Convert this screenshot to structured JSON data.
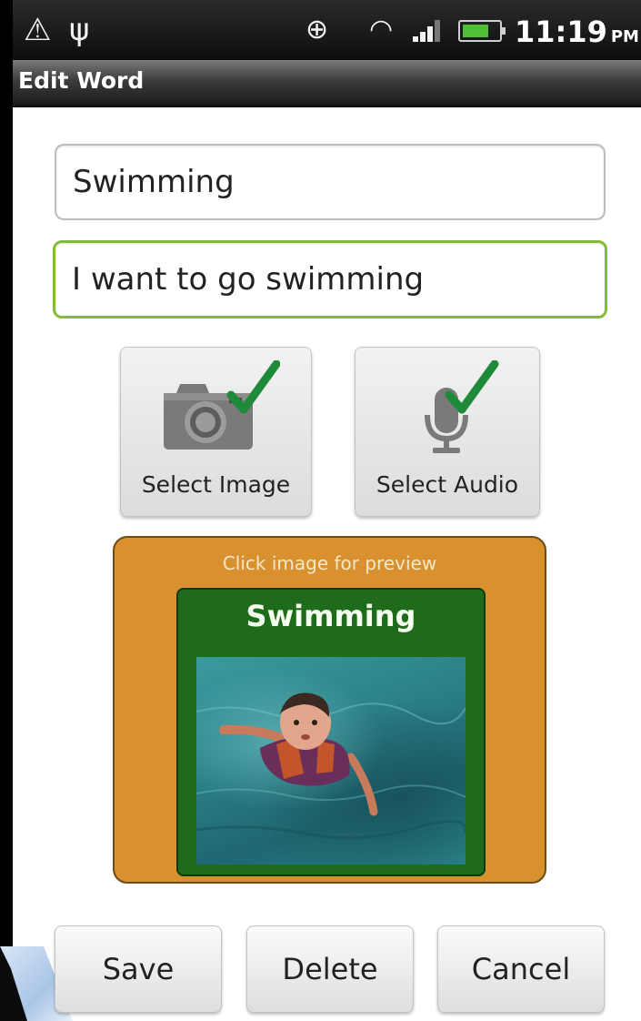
{
  "status_bar": {
    "time": "11:19",
    "ampm": "PM",
    "icons": [
      "warning-icon",
      "usb-icon",
      "gps-icon",
      "wifi-icon",
      "signal-icon",
      "battery-icon"
    ]
  },
  "title_bar": {
    "title": "Edit Word"
  },
  "form": {
    "word_value": "Swimming",
    "sentence_value": "I want to go swimming"
  },
  "media": {
    "select_image_label": "Select Image",
    "select_audio_label": "Select Audio",
    "image_selected": true,
    "audio_selected": true
  },
  "preview": {
    "hint": "Click image for preview",
    "tile_title": "Swimming"
  },
  "actions": {
    "save_label": "Save",
    "delete_label": "Delete",
    "cancel_label": "Cancel"
  },
  "colors": {
    "preview_card": "#d9902e",
    "preview_tile": "#1e6b1c",
    "check_mark": "#1f8a3a",
    "focused_input_border": "#86bb3a"
  }
}
